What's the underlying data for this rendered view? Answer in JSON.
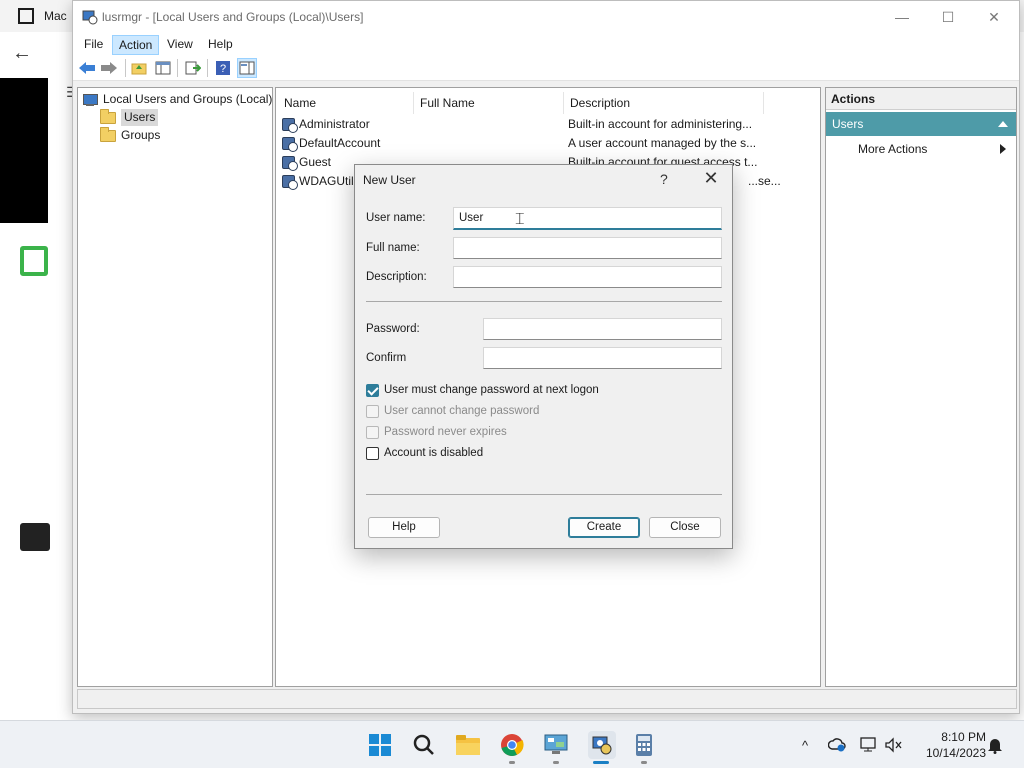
{
  "background_app": {
    "title": "Mac"
  },
  "window": {
    "title": "lusrmgr - [Local Users and Groups (Local)\\Users]",
    "min": "—",
    "max": "☐",
    "close": "✕"
  },
  "menu": {
    "file": "File",
    "action": "Action",
    "view": "View",
    "help": "Help"
  },
  "tree": {
    "root": "Local Users and Groups (Local)",
    "items": [
      {
        "label": "Users"
      },
      {
        "label": "Groups"
      }
    ]
  },
  "list": {
    "columns": [
      "Name",
      "Full Name",
      "Description"
    ],
    "rows": [
      {
        "name": "Administrator",
        "full_name": "",
        "description": "Built-in account for administering..."
      },
      {
        "name": "DefaultAccount",
        "full_name": "",
        "description": "A user account managed by the s..."
      },
      {
        "name": "Guest",
        "full_name": "",
        "description": "Built-in account for guest access t..."
      },
      {
        "name": "WDAGUtili",
        "full_name": "",
        "description": "...se..."
      }
    ]
  },
  "actions": {
    "header": "Actions",
    "section": "Users",
    "more": "More Actions"
  },
  "dialog": {
    "title": "New User",
    "help_glyph": "?",
    "close_glyph": "✕",
    "username_label": "User name:",
    "username_value": "User",
    "fullname_label": "Full name:",
    "fullname_value": "",
    "description_label": "Description:",
    "description_value": "",
    "password_label": "Password:",
    "confirm_label": "Confirm",
    "checkboxes": [
      {
        "label": "User must change password at next logon",
        "checked": true,
        "enabled": true
      },
      {
        "label": "User cannot change password",
        "checked": false,
        "enabled": false
      },
      {
        "label": "Password never expires",
        "checked": false,
        "enabled": false
      },
      {
        "label": "Account is disabled",
        "checked": false,
        "enabled": true
      }
    ],
    "help_button": "Help",
    "create_button": "Create",
    "close_button": "Close"
  },
  "taskbar": {
    "time": "8:10 PM",
    "date": "10/14/2023",
    "chevron": "^"
  },
  "colors": {
    "accent": "#2e7d9a",
    "actions_selected": "#4e9ba8"
  }
}
